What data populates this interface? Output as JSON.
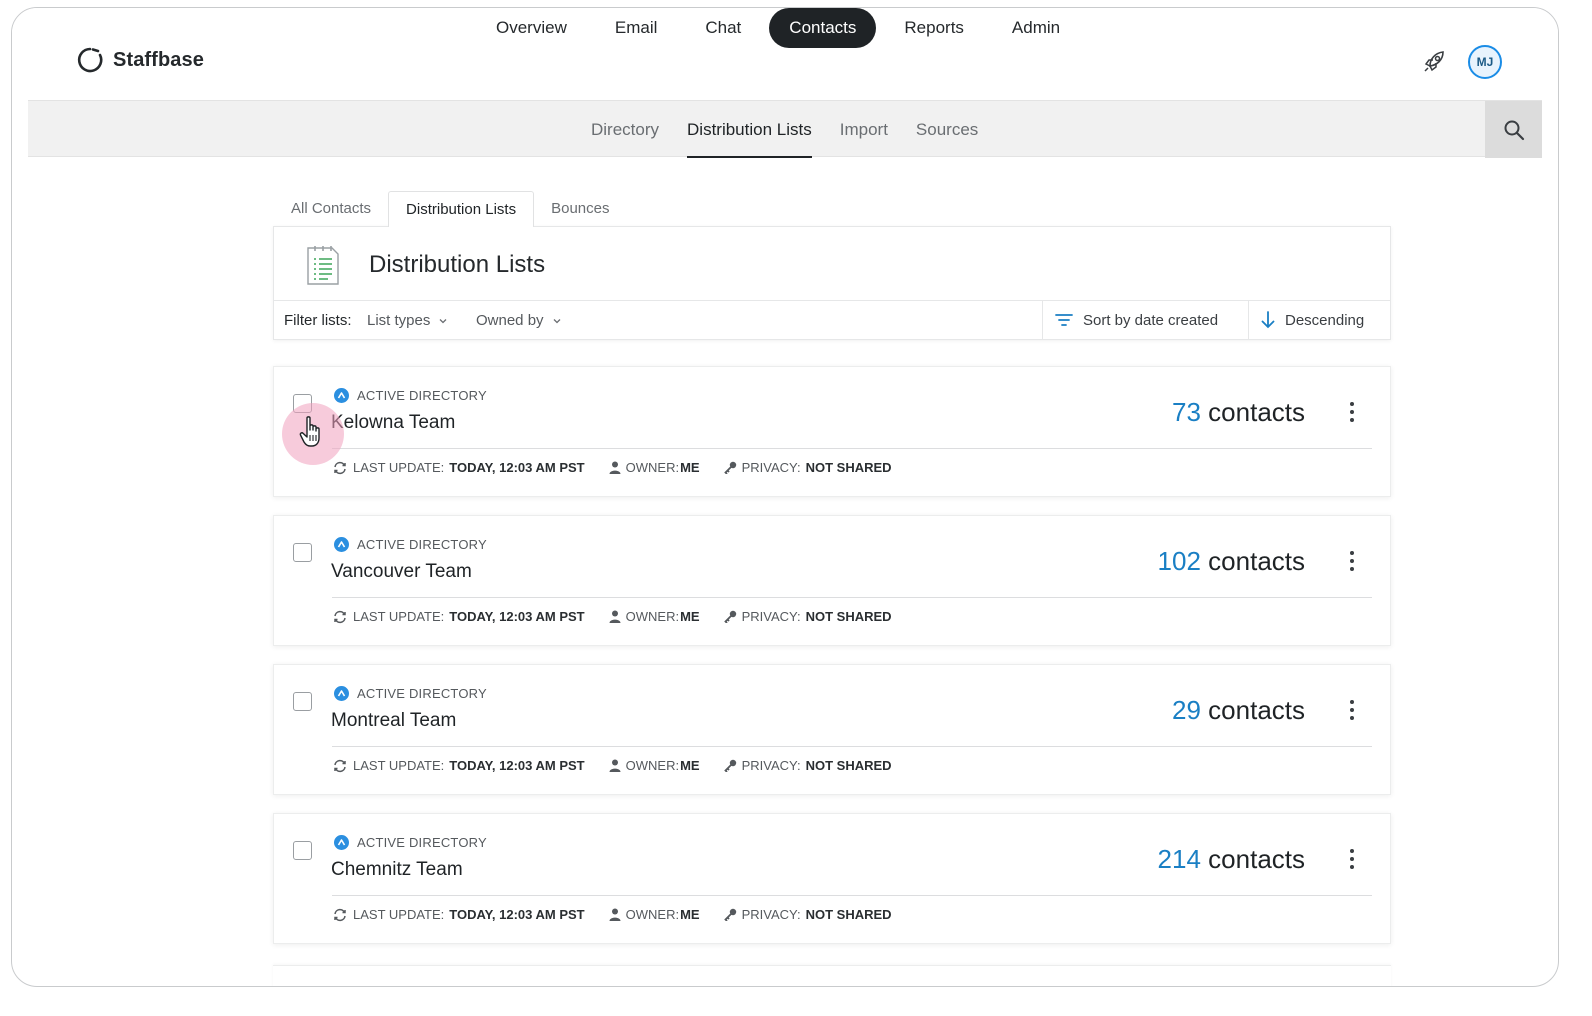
{
  "app": {
    "brand": "Staffbase",
    "user_initials": "MJ"
  },
  "main_nav": [
    {
      "label": "Overview",
      "active": false
    },
    {
      "label": "Email",
      "active": false
    },
    {
      "label": "Chat",
      "active": false
    },
    {
      "label": "Contacts",
      "active": true
    },
    {
      "label": "Reports",
      "active": false
    },
    {
      "label": "Admin",
      "active": false
    }
  ],
  "sub_nav": [
    {
      "label": "Directory",
      "active": false
    },
    {
      "label": "Distribution Lists",
      "active": true
    },
    {
      "label": "Import",
      "active": false
    },
    {
      "label": "Sources",
      "active": false
    }
  ],
  "tabs": [
    {
      "label": "All Contacts",
      "active": false
    },
    {
      "label": "Distribution Lists",
      "active": true
    },
    {
      "label": "Bounces",
      "active": false
    }
  ],
  "panel": {
    "title": "Distribution Lists",
    "filter_label": "Filter lists:",
    "list_types": "List types",
    "owned_by": "Owned by",
    "sort": "Sort by date created",
    "order": "Descending"
  },
  "labels": {
    "source": "ACTIVE DIRECTORY",
    "last_update": "LAST UPDATE:",
    "owner": "OWNER:",
    "privacy": "PRIVACY:",
    "contacts": "contacts"
  },
  "lists": [
    {
      "name": "Kelowna Team",
      "count": "73",
      "last_update": "TODAY, 12:03 AM PST",
      "owner": "ME",
      "privacy": "NOT SHARED"
    },
    {
      "name": "Vancouver Team",
      "count": "102",
      "last_update": "TODAY, 12:03 AM PST",
      "owner": "ME",
      "privacy": "NOT SHARED"
    },
    {
      "name": "Montreal Team",
      "count": "29",
      "last_update": "TODAY, 12:03 AM PST",
      "owner": "ME",
      "privacy": "NOT SHARED"
    },
    {
      "name": "Chemnitz Team",
      "count": "214",
      "last_update": "TODAY, 12:03 AM PST",
      "owner": "ME",
      "privacy": "NOT SHARED"
    }
  ],
  "colors": {
    "accent": "#1a7fc4",
    "active_nav_bg": "#1f2326",
    "source_badge": "#2b8fe0"
  }
}
